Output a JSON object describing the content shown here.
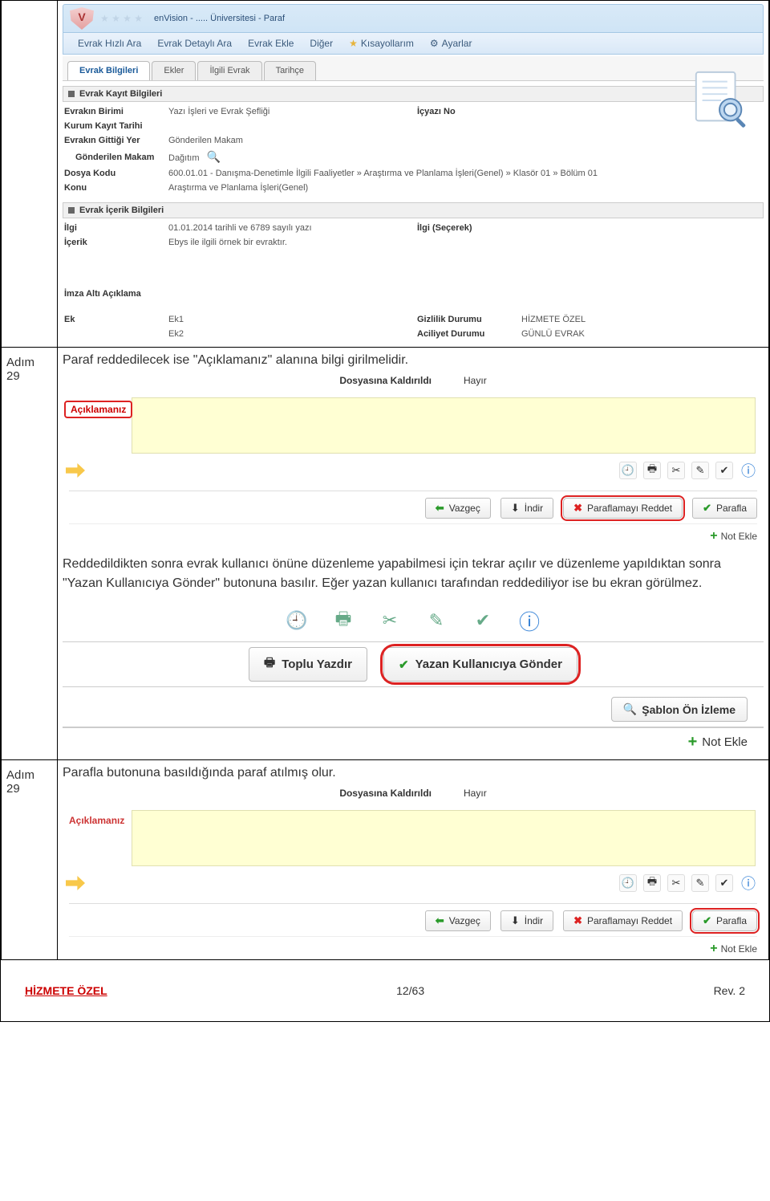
{
  "titlebar": {
    "app_title": "enVision - ..... Üniversitesi - Paraf"
  },
  "menu": {
    "hizli_ara": "Evrak Hızlı Ara",
    "detayli_ara": "Evrak Detaylı Ara",
    "evrak_ekle": "Evrak Ekle",
    "diger": "Diğer",
    "kisayollarim": "Kısayollarım",
    "ayarlar": "Ayarlar"
  },
  "tabs": {
    "bilgileri": "Evrak Bilgileri",
    "ekler": "Ekler",
    "ilgili": "İlgili Evrak",
    "tarihce": "Tarihçe"
  },
  "sections": {
    "kayit": "Evrak Kayıt Bilgileri",
    "icerik": "Evrak İçerik Bilgileri"
  },
  "form": {
    "evrakin_birimi_lbl": "Evrakın Birimi",
    "evrakin_birimi_val": "Yazı İşleri ve Evrak Şefliği",
    "icyazi_no_lbl": "İçyazı No",
    "kurum_kayit_lbl": "Kurum Kayıt Tarihi",
    "gittigi_yer_lbl": "Evrakın Gittiği Yer",
    "gittigi_yer_val": "Gönderilen Makam",
    "gonderilen_makam_lbl": "Gönderilen Makam",
    "gonderilen_makam_val": "Dağıtım",
    "dosya_kodu_lbl": "Dosya Kodu",
    "dosya_kodu_val": "600.01.01 - Danışma-Denetimle İlgili Faaliyetler » Araştırma ve Planlama İşleri(Genel) » Klasör 01 » Bölüm 01",
    "konu_lbl": "Konu",
    "konu_val": "Araştırma ve Planlama İşleri(Genel)",
    "ilgi_lbl": "İlgi",
    "ilgi_val": "01.01.2014 tarihli ve 6789 sayılı yazı",
    "ilgi_sec_lbl": "İlgi (Seçerek)",
    "icerik_lbl": "İçerik",
    "icerik_val": "Ebys ile ilgili örnek bir evraktır.",
    "imza_alti_lbl": "İmza Altı Açıklama",
    "ek_lbl": "Ek",
    "ek1": "Ek1",
    "ek2": "Ek2",
    "gizlilik_lbl": "Gizlilik Durumu",
    "gizlilik_val": "HİZMETE ÖZEL",
    "aciliyet_lbl": "Aciliyet Durumu",
    "aciliyet_val": "GÜNLÜ EVRAK"
  },
  "panel": {
    "dosyasina": "Dosyasına Kaldırıldı",
    "hayir": "Hayır",
    "aciklamaniz": "Açıklamanız",
    "vazgec": "Vazgeç",
    "indir": "İndir",
    "reddet": "Paraflamayı Reddet",
    "parafla": "Parafla",
    "not_ekle": "Not Ekle",
    "toplu_yazdir": "Toplu Yazdır",
    "yazan_gonder": "Yazan Kullanıcıya Gönder",
    "sablon": "Şablon Ön İzleme"
  },
  "steps": {
    "adim": "Adım",
    "no29": "29",
    "s29a": "Paraf reddedilecek ise \"Açıklamanız\" alanına bilgi girilmelidir.",
    "s29b_p1": "Reddedildikten sonra evrak kullanıcı önüne düzenleme yapabilmesi için tekrar açılır ve düzenleme yapıldıktan sonra \"Yazan Kullanıcıya Gönder\" butonuna basılır. Eğer yazan kullanıcı tarafından reddediliyor ise bu ekran görülmez.",
    "s29c": "Parafla butonuna basıldığında paraf atılmış olur."
  },
  "footer": {
    "left": "HİZMETE ÖZEL",
    "center": "12/63",
    "right": "Rev. 2"
  }
}
